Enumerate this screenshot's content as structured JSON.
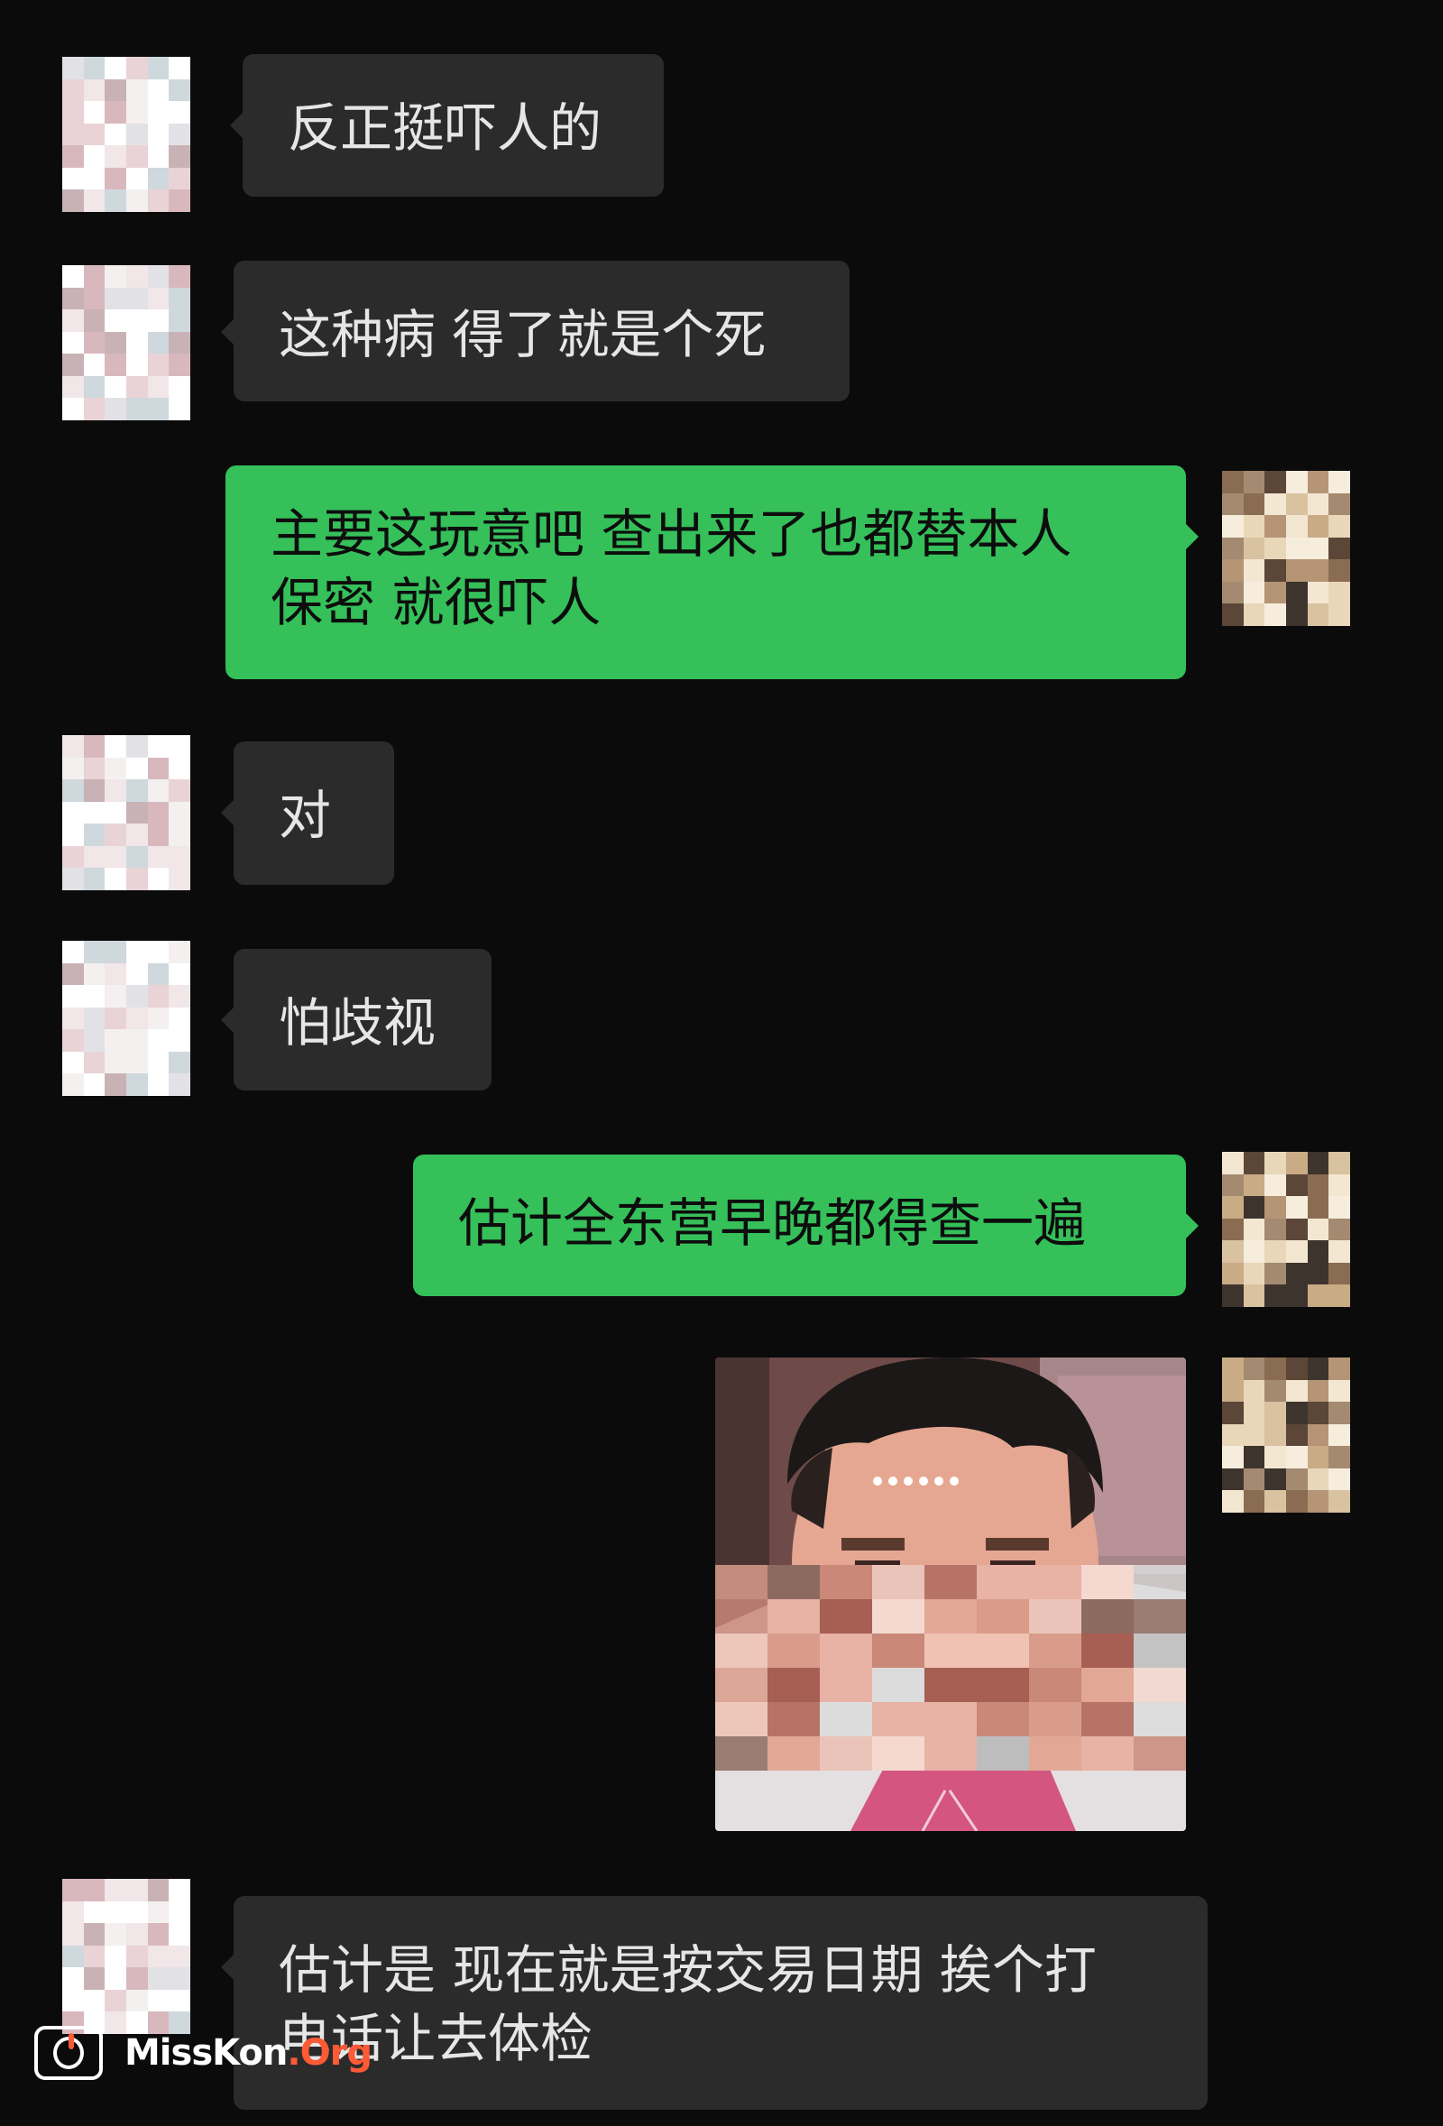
{
  "colors": {
    "background": "#0b0b0b",
    "incoming_bubble": "#2b2b2b",
    "incoming_text": "#e6e6e6",
    "outgoing_bubble": "#35c05a",
    "outgoing_text": "#0d0d0d"
  },
  "messages": [
    {
      "direction": "incoming",
      "text": "反正挺吓人的",
      "avatar": "blurred-avatar-pink"
    },
    {
      "direction": "incoming",
      "text": "这种病 得了就是个死",
      "avatar": "blurred-avatar-pink"
    },
    {
      "direction": "outgoing",
      "text": "主要这玩意吧 查出来了也都替本人\n保密 就很吓人",
      "avatar": "blurred-avatar-brown"
    },
    {
      "direction": "incoming",
      "text": "对",
      "avatar": "blurred-avatar-pink"
    },
    {
      "direction": "incoming",
      "text": "怕歧视",
      "avatar": "blurred-avatar-pink"
    },
    {
      "direction": "outgoing",
      "text": "估计全东营早晚都得查一遍",
      "avatar": "blurred-avatar-brown"
    },
    {
      "direction": "outgoing",
      "type": "image",
      "image": "pixelated-face-photo",
      "avatar": "blurred-avatar-brown"
    },
    {
      "direction": "incoming",
      "text": "估计是 现在就是按交易日期 挨个打\n电话让去体检",
      "avatar": "blurred-avatar-pink"
    }
  ],
  "watermark": {
    "icon": "misskon-camera-logo-icon",
    "main": "MissKon",
    "ext": ".Org"
  }
}
